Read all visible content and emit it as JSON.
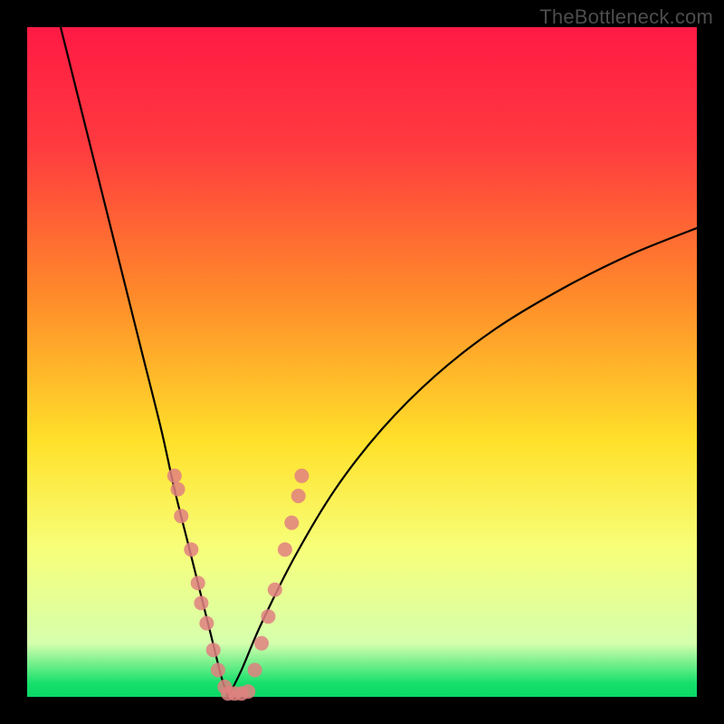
{
  "watermark": "TheBottleneck.com",
  "colors": {
    "red": "#ff1a44",
    "red2": "#ff3b3f",
    "orange": "#ff8a2a",
    "yellow": "#ffe12a",
    "pale": "#f7ff7a",
    "pale2": "#d6ffad",
    "green": "#15e06b",
    "green2": "#0bd765",
    "dot": "#e08080",
    "curve": "#000000"
  },
  "chart_data": {
    "type": "line",
    "title": "",
    "xlabel": "",
    "ylabel": "",
    "xlim": [
      0,
      100
    ],
    "ylim": [
      0,
      100
    ],
    "vertex_x": 30,
    "curve_note": "V-shaped bottleneck curve; left branch steep from top-left down to vertex near x≈30 at y≈0, right branch rises with diminishing slope toward upper-right reaching y≈70 at x=100.",
    "series": [
      {
        "name": "left-branch",
        "x": [
          5,
          8,
          11,
          14,
          17,
          20,
          22,
          24,
          26,
          27.5,
          29,
          30
        ],
        "y": [
          100,
          88,
          76,
          64,
          52,
          40,
          31,
          23,
          15,
          9,
          3,
          0
        ]
      },
      {
        "name": "right-branch",
        "x": [
          30,
          32,
          35,
          40,
          46,
          53,
          61,
          70,
          80,
          90,
          100
        ],
        "y": [
          0,
          4,
          11,
          21,
          31,
          40,
          48,
          55,
          61,
          66,
          70
        ]
      }
    ],
    "scatter": {
      "name": "data-points",
      "points": [
        {
          "x": 22.0,
          "y": 33
        },
        {
          "x": 22.5,
          "y": 31
        },
        {
          "x": 23.0,
          "y": 27
        },
        {
          "x": 24.5,
          "y": 22
        },
        {
          "x": 25.5,
          "y": 17
        },
        {
          "x": 26.0,
          "y": 14
        },
        {
          "x": 26.8,
          "y": 11
        },
        {
          "x": 27.8,
          "y": 7
        },
        {
          "x": 28.5,
          "y": 4
        },
        {
          "x": 29.5,
          "y": 1.5
        },
        {
          "x": 30.0,
          "y": 0.5
        },
        {
          "x": 31.0,
          "y": 0.5
        },
        {
          "x": 32.0,
          "y": 0.5
        },
        {
          "x": 33.0,
          "y": 0.8
        },
        {
          "x": 34.0,
          "y": 4
        },
        {
          "x": 35.0,
          "y": 8
        },
        {
          "x": 36.0,
          "y": 12
        },
        {
          "x": 37.0,
          "y": 16
        },
        {
          "x": 38.5,
          "y": 22
        },
        {
          "x": 39.5,
          "y": 26
        },
        {
          "x": 40.5,
          "y": 30
        },
        {
          "x": 41.0,
          "y": 33
        }
      ],
      "radius": 8
    }
  }
}
